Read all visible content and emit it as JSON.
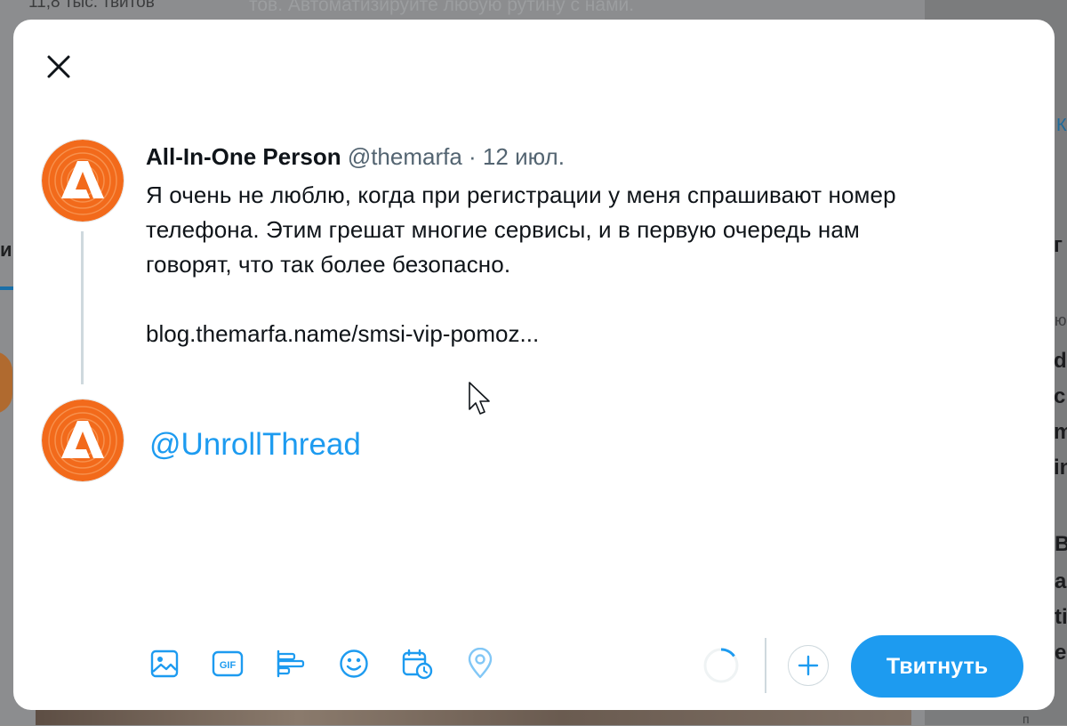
{
  "background": {
    "tweet_count": "11,8 тыс. твитов",
    "faded_text": "тов. Автоматизируйте любую рутину с нами.",
    "left_fragment": "и",
    "right_fragments": [
      "К",
      "г",
      "ю",
      "de",
      "ch",
      "m",
      "in",
      "В",
      "а",
      "ti",
      "e",
      "п"
    ]
  },
  "modal": {
    "close_icon": "close-icon",
    "original_tweet": {
      "author_name": "All-In-One Person",
      "handle": "@themarfa",
      "separator": " · ",
      "date": "12 июл.",
      "body_lines": [
        "Я очень не люблю, когда при регистрации у меня спрашивают номер",
        "телефона. Этим грешат многие сервисы, и в первую очередь нам",
        "говорят, что так более безопасно."
      ],
      "link": "blog.themarfa.name/smsi-vip-pomoz..."
    },
    "reply": {
      "text": "@UnrollThread"
    },
    "toolbar": {
      "icons": [
        "image-icon",
        "gif-icon",
        "poll-icon",
        "emoji-icon",
        "schedule-icon",
        "location-icon"
      ],
      "gif_label": "GIF",
      "character_progress": 0.15,
      "add_icon": "plus-icon",
      "tweet_button": "Твитнуть"
    },
    "colors": {
      "accent": "#1d9bf0",
      "avatar_orange": "#f26a1b",
      "text": "#0f1419",
      "muted": "#536471"
    }
  }
}
